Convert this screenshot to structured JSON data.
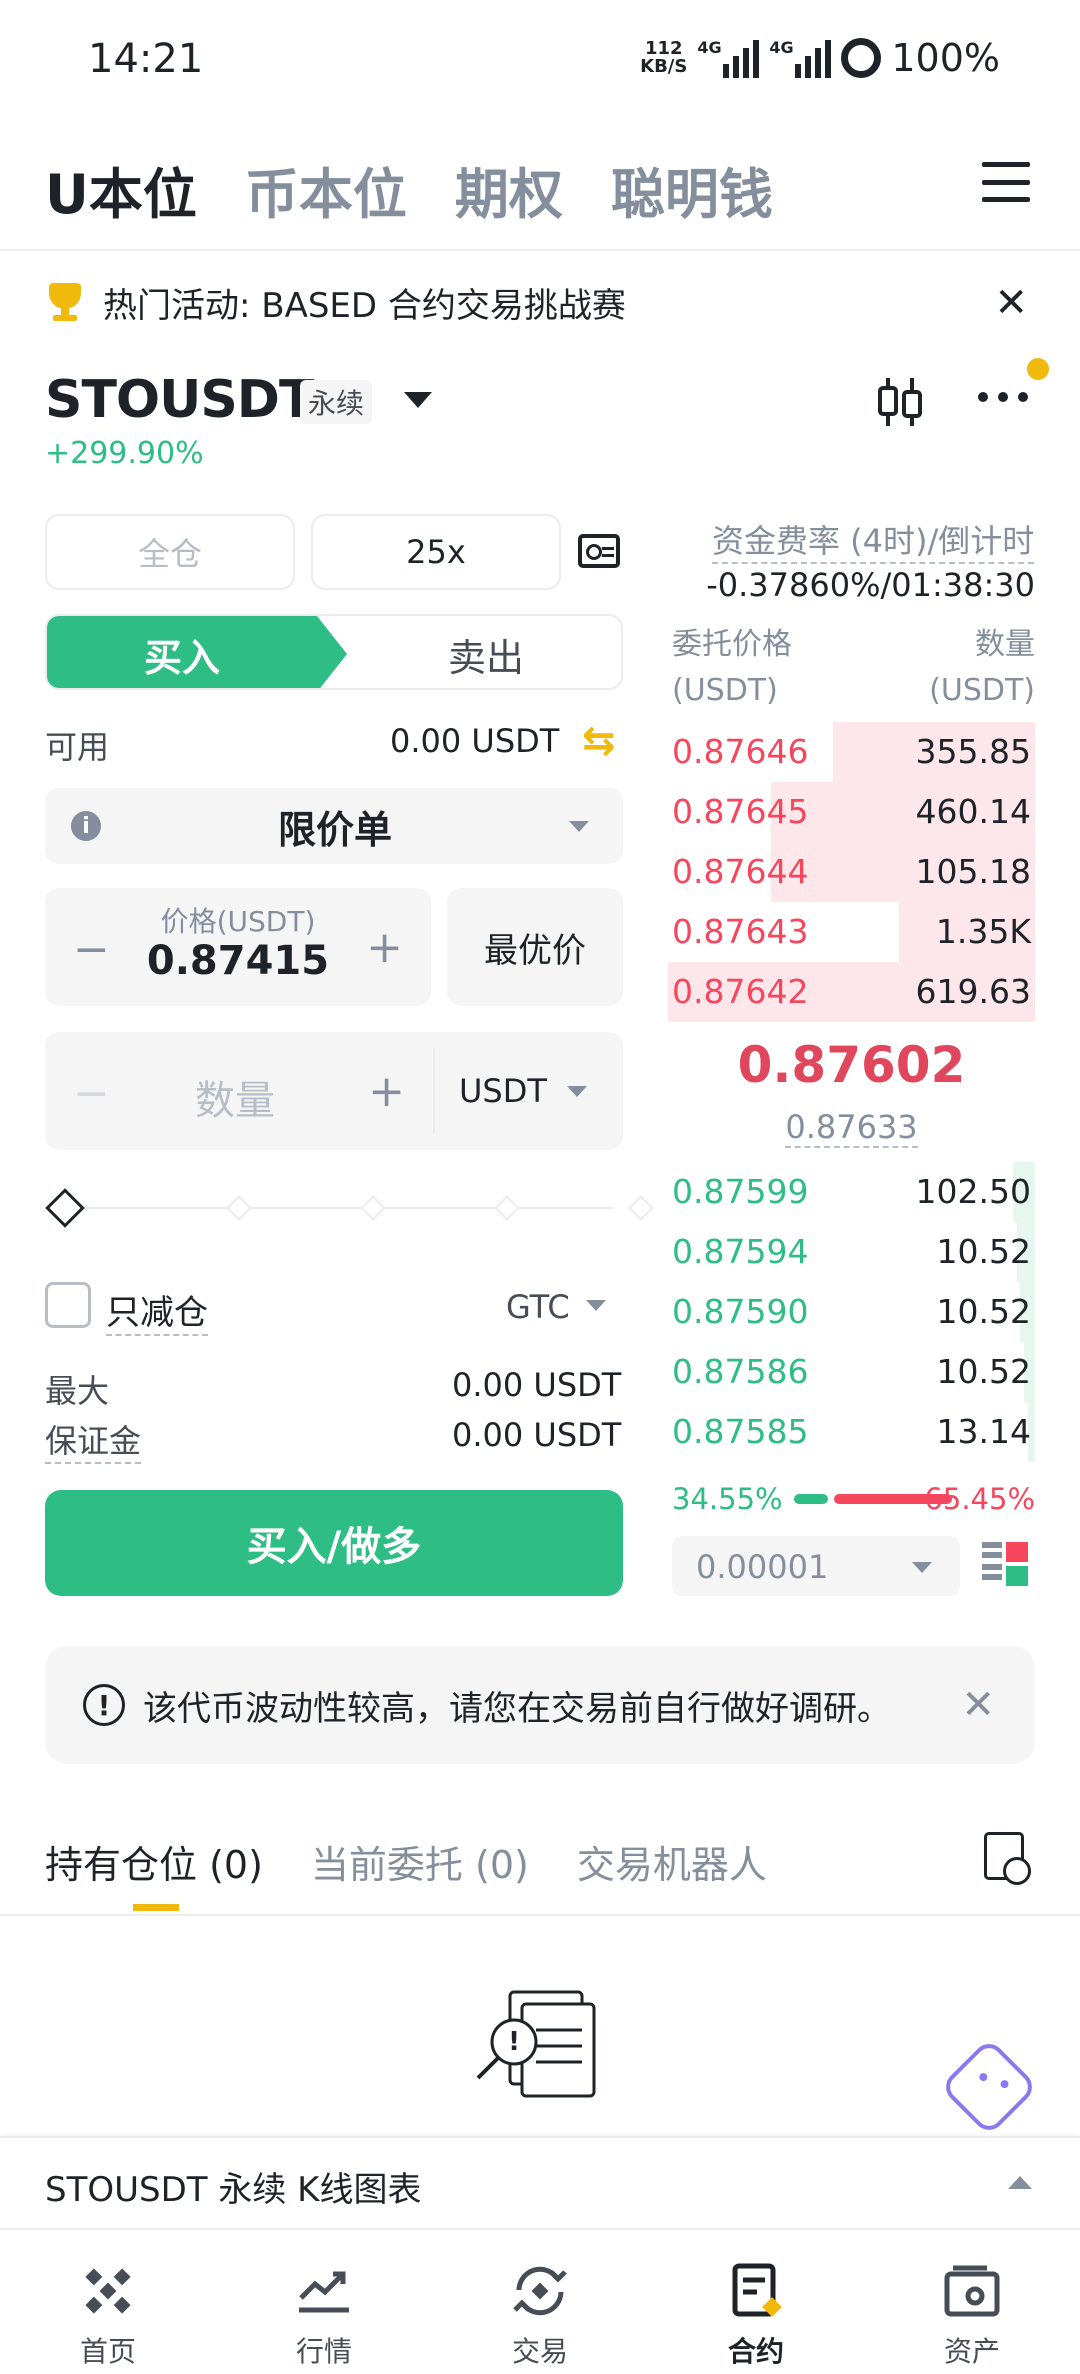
{
  "status_bar": {
    "time": "14:21",
    "speed_value": "112",
    "speed_unit": "KB/S",
    "network_1": "4G",
    "network_2": "4G",
    "battery": "100%"
  },
  "top_tabs": [
    {
      "label": "U本位",
      "active": true
    },
    {
      "label": "币本位",
      "active": false
    },
    {
      "label": "期权",
      "active": false
    },
    {
      "label": "聪明钱",
      "active": false
    }
  ],
  "banner": {
    "text": "热门活动: BASED 合约交易挑战赛"
  },
  "symbol": {
    "name": "STOUSDT",
    "badge": "永续",
    "change": "+299.90%"
  },
  "order_form": {
    "margin_mode": "全仓",
    "leverage": "25x",
    "buy_tab": "买入",
    "sell_tab": "卖出",
    "available_label": "可用",
    "available_value": "0.00 USDT",
    "order_type": "限价单",
    "price_label": "价格(USDT)",
    "price_value": "0.87415",
    "best_price": "最优价",
    "quantity_placeholder": "数量",
    "quantity_unit": "USDT",
    "slider_percent": 0,
    "reduce_only": "只减仓",
    "tif": "GTC",
    "max_label": "最大",
    "max_value": "0.00 USDT",
    "margin_label": "保证金",
    "margin_value": "0.00 USDT",
    "submit": "买入/做多"
  },
  "order_book": {
    "funding_label": "资金费率 (4时)/倒计时",
    "funding_value": "-0.37860%/01:38:30",
    "price_header": "委托价格",
    "price_unit": "(USDT)",
    "qty_header": "数量",
    "qty_unit": "(USDT)",
    "asks": [
      {
        "price": "0.87646",
        "qty": "355.85",
        "depth": 0.55
      },
      {
        "price": "0.87645",
        "qty": "460.14",
        "depth": 0.72
      },
      {
        "price": "0.87644",
        "qty": "105.18",
        "depth": 0.72
      },
      {
        "price": "0.87643",
        "qty": "1.35K",
        "depth": 0.37
      },
      {
        "price": "0.87642",
        "qty": "619.63",
        "depth": 1.0
      }
    ],
    "last_price": "0.87602",
    "mark_price": "0.87633",
    "bids": [
      {
        "price": "0.87599",
        "qty": "102.50",
        "depth": 0.06
      },
      {
        "price": "0.87594",
        "qty": "10.52",
        "depth": 0.05
      },
      {
        "price": "0.87590",
        "qty": "10.52",
        "depth": 0.04
      },
      {
        "price": "0.87586",
        "qty": "10.52",
        "depth": 0.03
      },
      {
        "price": "0.87585",
        "qty": "13.14",
        "depth": 0.02
      }
    ],
    "buy_ratio": "34.55%",
    "sell_ratio": "65.45%",
    "step": "0.00001"
  },
  "warning": {
    "text": "该代币波动性较高，请您在交易前自行做好调研。"
  },
  "position_tabs": [
    {
      "label": "持有仓位 (0)",
      "active": true
    },
    {
      "label": "当前委托 (0)",
      "active": false
    },
    {
      "label": "交易机器人",
      "active": false
    }
  ],
  "kline": {
    "label": "STOUSDT 永续 K线图表"
  },
  "bottom_nav": [
    {
      "label": "首页",
      "icon": "home-icon",
      "active": false
    },
    {
      "label": "行情",
      "icon": "markets-icon",
      "active": false
    },
    {
      "label": "交易",
      "icon": "trade-icon",
      "active": false
    },
    {
      "label": "合约",
      "icon": "futures-icon",
      "active": true
    },
    {
      "label": "资产",
      "icon": "wallet-icon",
      "active": false
    }
  ],
  "colors": {
    "buy": "#2ebd85",
    "sell": "#f6465d",
    "accent": "#f0b90b"
  }
}
